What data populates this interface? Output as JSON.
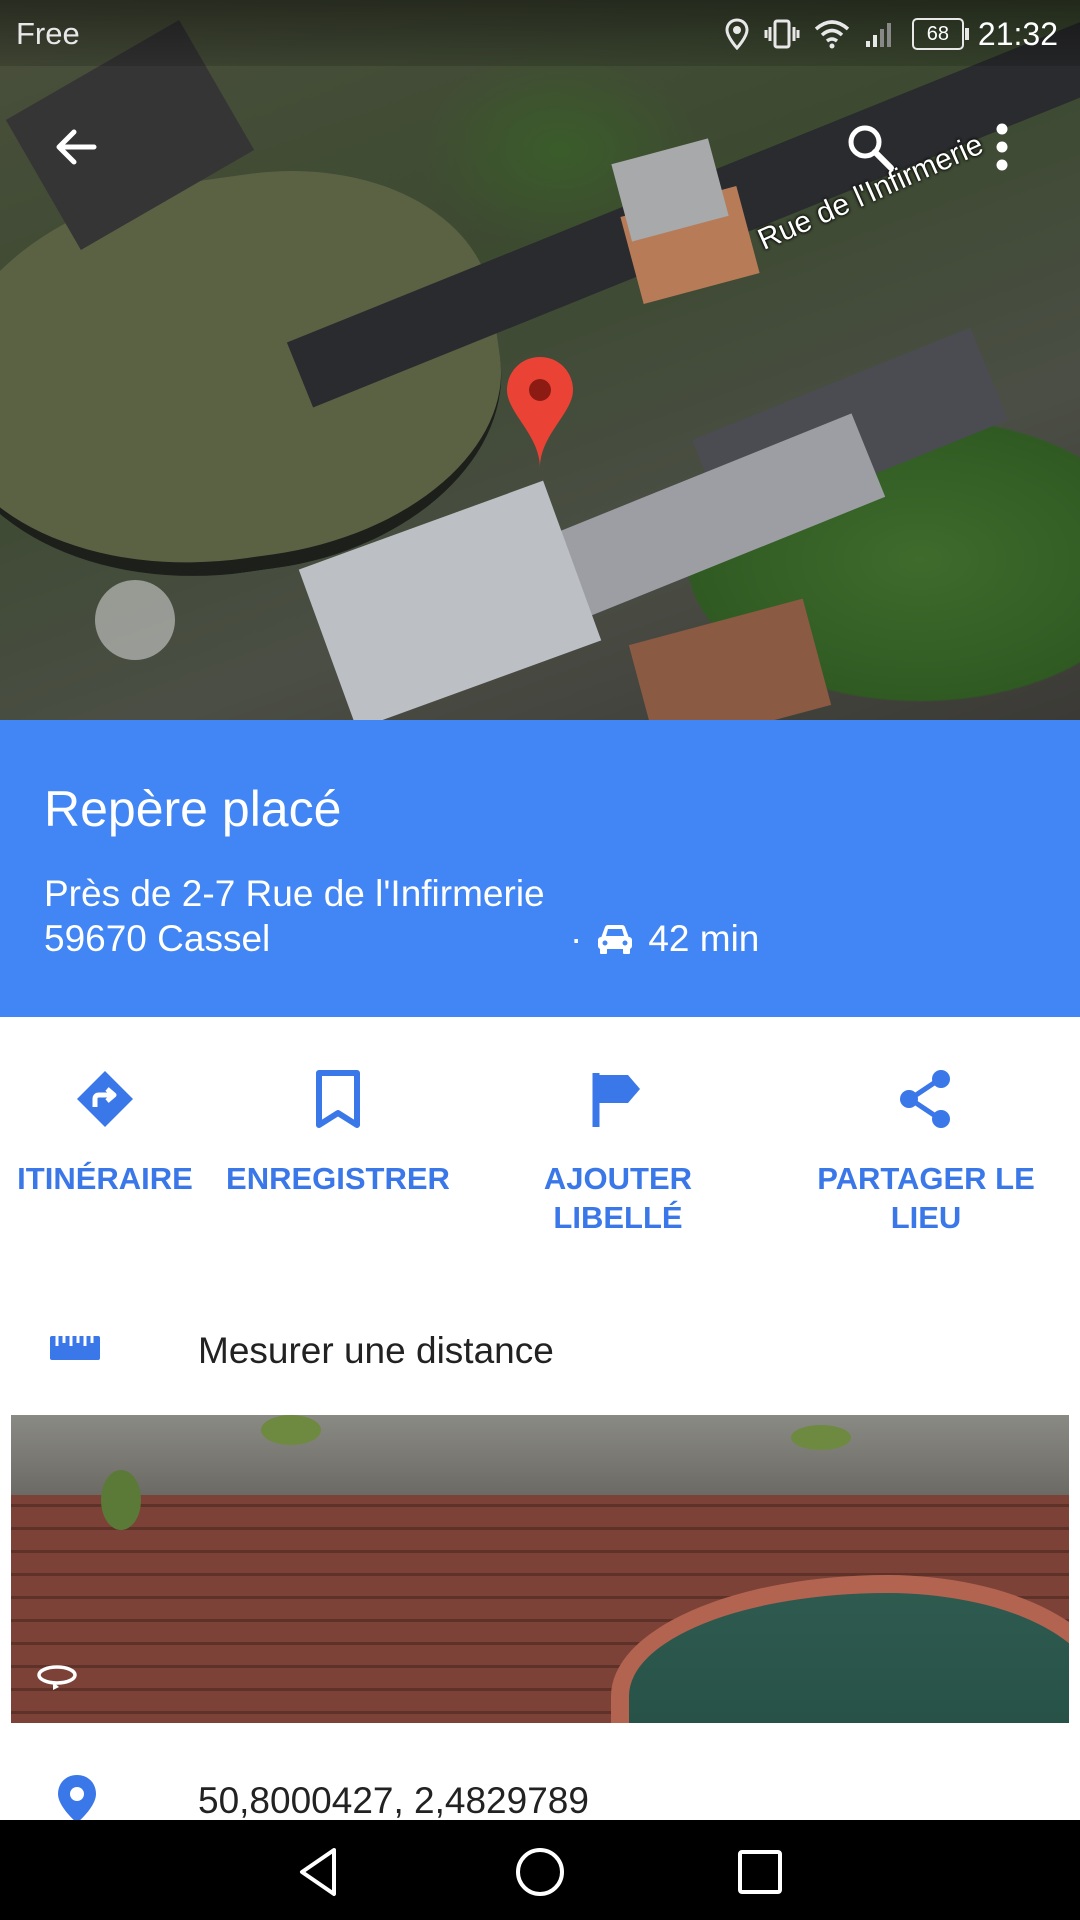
{
  "status_bar": {
    "carrier": "Free",
    "battery": "68",
    "time": "21:32"
  },
  "map": {
    "street_label": "Rue de l'Infirmerie"
  },
  "place": {
    "title": "Repère placé",
    "address_line1": "Près de 2-7 Rue de l'Infirmerie",
    "address_line2": "59670 Cassel",
    "separator": "·",
    "travel_time": "42 min"
  },
  "actions": {
    "directions": "ITINÉRAIRE",
    "save": "ENREGISTRER",
    "label_line1": "AJOUTER",
    "label_line2": "LIBELLÉ",
    "share_line1": "PARTAGER LE",
    "share_line2": "LIEU"
  },
  "measure": {
    "label": "Mesurer une distance"
  },
  "coordinates": {
    "value": "50,8000427, 2,4829789"
  },
  "colors": {
    "panel_blue": "#4285f4",
    "action_blue": "#3a77e8",
    "pin_red": "#ea4335"
  },
  "icons": [
    "back-arrow-icon",
    "search-icon",
    "more-vert-icon",
    "car-icon",
    "directions-icon",
    "bookmark-icon",
    "flag-icon",
    "share-icon",
    "ruler-icon",
    "street-view-icon",
    "location-pin-icon"
  ]
}
